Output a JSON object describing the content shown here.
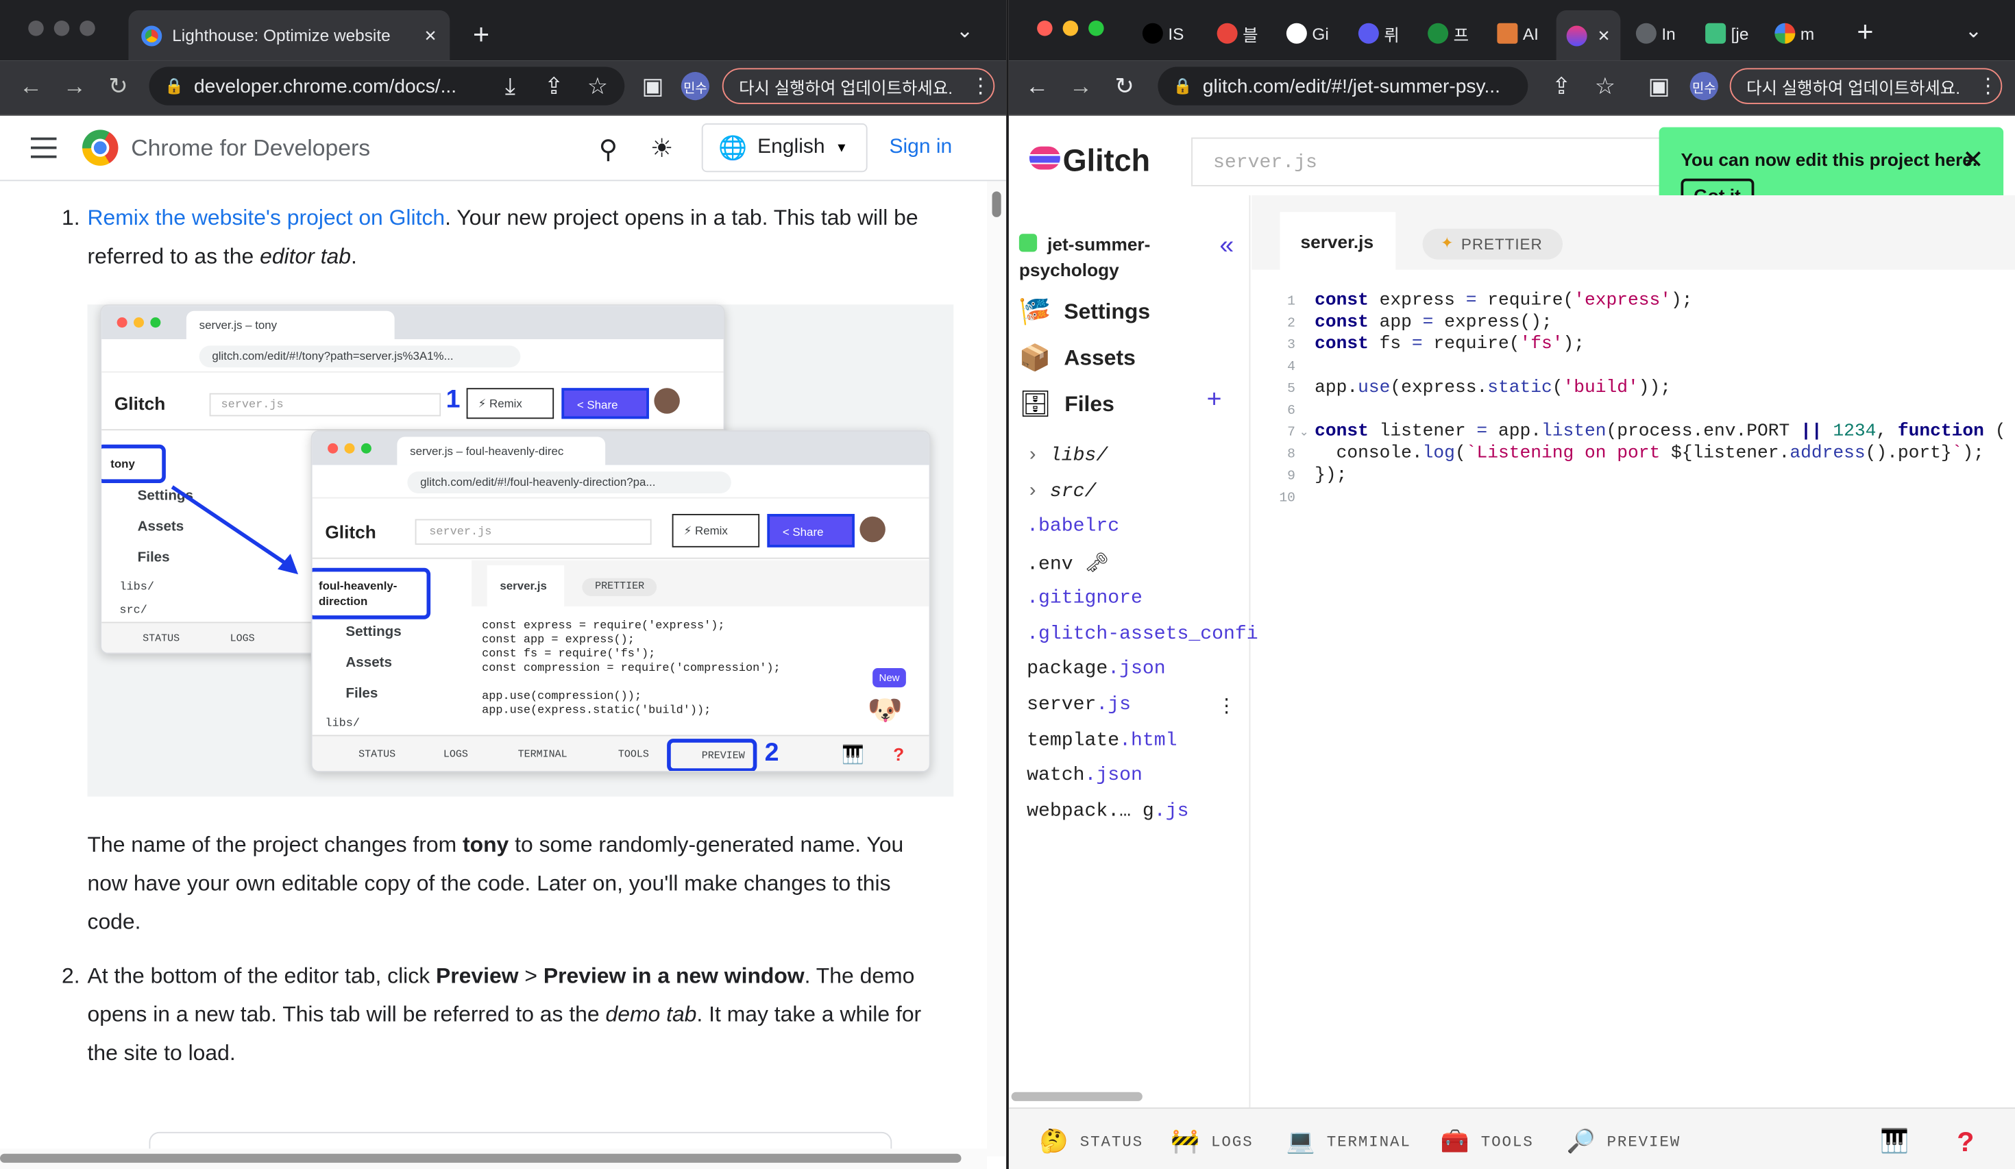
{
  "left_window": {
    "tab": {
      "title": "Lighthouse: Optimize website",
      "close": "✕",
      "new_tab": "+",
      "chevron": "⌄"
    },
    "url": "developer.chrome.com/docs/...",
    "profile": "민수",
    "update_notice": "다시 실행하여 업데이트하세요.",
    "site": {
      "name": "Chrome for Developers",
      "language": "English",
      "signin": "Sign in"
    },
    "doc": {
      "step1_marker": "1.",
      "step1_link": "Remix the website's project on Glitch",
      "step1_text_a": ". Your new project opens in a tab. This tab will be referred to as the ",
      "step1_em": "editor tab",
      "step1_text_b": ".",
      "para_a": "The name of the project changes from ",
      "para_bold": "tony",
      "para_b": " to some randomly-generated name. You now have your own editable copy of the code. Later on, you'll make changes to this code.",
      "step2_marker": "2.",
      "step2_a": "At the bottom of the editor tab, click ",
      "step2_b1": "Preview",
      "step2_gt": " > ",
      "step2_b2": "Preview in a new window",
      "step2_c": ". The demo opens in a new tab. This tab will be referred to as the ",
      "step2_em": "demo tab",
      "step2_d": ". It may take a while for the site to load."
    },
    "illustration": {
      "back": {
        "tab": "server.js – tony",
        "url": "glitch.com/edit/#!/tony?path=server.js%3A1%...",
        "logo": "Glitch",
        "search": "server.js",
        "step": "1",
        "remix": "⚡ Remix",
        "share": "< Share",
        "project": "tony",
        "items": [
          "Settings",
          "Assets",
          "Files"
        ],
        "folders": [
          "libs/",
          "src/"
        ],
        "status": [
          "STATUS",
          "LOGS"
        ]
      },
      "front": {
        "tab": "server.js – foul-heavenly-direc",
        "url": "glitch.com/edit/#!/foul-heavenly-direction?pa...",
        "logo": "Glitch",
        "search": "server.js",
        "remix": "⚡ Remix",
        "share": "< Share",
        "project": "foul-heavenly-direction",
        "file_tab": "server.js",
        "prettier": "PRETTIER",
        "items": [
          "Settings",
          "Assets",
          "Files"
        ],
        "folders": [
          "libs/"
        ],
        "code": [
          "const express = require('express');",
          "const app = express();",
          "const fs = require('fs');",
          "const compression = require('compression');",
          "",
          "app.use(compression());",
          "app.use(express.static('build'));"
        ],
        "badge": "New",
        "bottom": [
          "STATUS",
          "LOGS",
          "TERMINAL",
          "TOOLS",
          "PREVIEW"
        ],
        "step": "2"
      }
    }
  },
  "right_window": {
    "tabs": [
      "IS",
      "블",
      "Gi",
      "뤼",
      "프",
      "AI",
      "",
      "In",
      "[je",
      "m"
    ],
    "url": "glitch.com/edit/#!/jet-summer-psy...",
    "profile": "민수",
    "update_notice": "다시 실행하여 업데이트하세요.",
    "glitch": {
      "logo": "Glitch",
      "search_placeholder": "server.js",
      "toast": {
        "message": "You can now edit this project here.",
        "button": "Got it"
      },
      "project_name": "jet-summer-psychology",
      "sidebar": {
        "settings": "Settings",
        "assets": "Assets",
        "files": "Files"
      },
      "files": [
        {
          "base": "libs/",
          "ext": ""
        },
        {
          "base": "src/",
          "ext": ""
        },
        {
          "base": "",
          "ext": ".babelrc"
        },
        {
          "base": ".env",
          "ext": ""
        },
        {
          "base": "",
          "ext": ".gitignore"
        },
        {
          "base": "",
          "ext": ".glitch-assets_confi"
        },
        {
          "base": "package",
          "ext": ".json"
        },
        {
          "base": "server",
          "ext": ".js"
        },
        {
          "base": "template",
          "ext": ".html"
        },
        {
          "base": "watch",
          "ext": ".json"
        },
        {
          "base": "webpack.… g",
          "ext": ".js"
        }
      ],
      "editor_tab": "server.js",
      "prettier": "PRETTIER",
      "line_numbers": [
        "1",
        "2",
        "3",
        "4",
        "5",
        "6",
        "7",
        "8",
        "9",
        "10"
      ],
      "bottom": {
        "status": "STATUS",
        "logs": "LOGS",
        "terminal": "TERMINAL",
        "tools": "TOOLS",
        "preview": "PREVIEW"
      }
    }
  },
  "colors": {
    "chrome_dark": "#202124",
    "toolbar": "#35363a",
    "link": "#1a73e8",
    "glitch_purple": "#4c3bd8",
    "toast_green": "#5cf08d"
  }
}
